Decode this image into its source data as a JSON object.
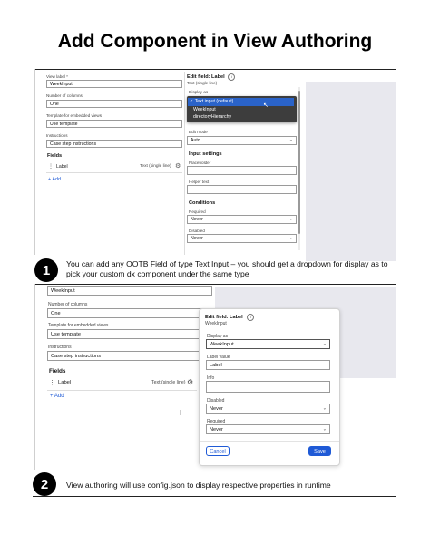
{
  "title": "Add Component in View Authoring",
  "step1": {
    "number": "1",
    "caption": "You can add any OOTB Field of type Text Input – you should get a dropdown for display as to pick your custom dx component under the same type",
    "form": {
      "view_label_label": "View label *",
      "view_label_value": "WeekInput",
      "columns_label": "Number of columns",
      "columns_value": "One",
      "template_label": "Template for embedded views",
      "template_value": "Use template",
      "instructions_label": "Instructions",
      "instructions_value": "Case step instructions",
      "fields_heading": "Fields",
      "field_name": "Label",
      "field_type": "Text (single line)",
      "add_label": "Add"
    },
    "edit_panel": {
      "title": "Edit field: Label",
      "subtitle": "Text (single line)",
      "display_as_label": "Display as",
      "dropdown_options": [
        "✓ Text input (default)",
        "WeekInput",
        "directoryHierarchy"
      ],
      "edit_mode_label": "Edit mode",
      "edit_mode_value": "Auto",
      "input_settings_heading": "Input settings",
      "placeholder_label": "Placeholder",
      "helper_text_label": "Helper text",
      "conditions_heading": "Conditions",
      "required_label": "Required",
      "required_value": "Never",
      "disabled_label": "Disabled",
      "disabled_value": "Never"
    }
  },
  "step2": {
    "number": "2",
    "caption": "View authoring will use config.json to display respective properties in runtime",
    "form": {
      "view_label_value": "WeekInput",
      "columns_label": "Number of columns",
      "columns_value": "One",
      "template_label": "Template for embedded views",
      "template_value": "Use template",
      "instructions_label": "Instructions",
      "instructions_value": "Case step instructions",
      "fields_heading": "Fields",
      "field_name": "Label",
      "field_type": "Text (single line)",
      "add_label": "Add"
    },
    "modal": {
      "title": "Edit field: Label",
      "subtitle": "WeekInput",
      "display_as_label": "Display as",
      "display_as_value": "WeekInput",
      "label_value_label": "Label value",
      "label_value": "Label",
      "info_label": "Info",
      "disabled_label": "Disabled",
      "disabled_value": "Never",
      "required_label": "Required",
      "required_value": "Never",
      "cancel_label": "Cancel",
      "save_label": "Save"
    }
  },
  "colors": {
    "accent": "#1f5ad6",
    "dropdown_bg": "#3d3d3d",
    "dropdown_selected": "#2a63c9",
    "gray_panel": "#e8e8ee"
  }
}
